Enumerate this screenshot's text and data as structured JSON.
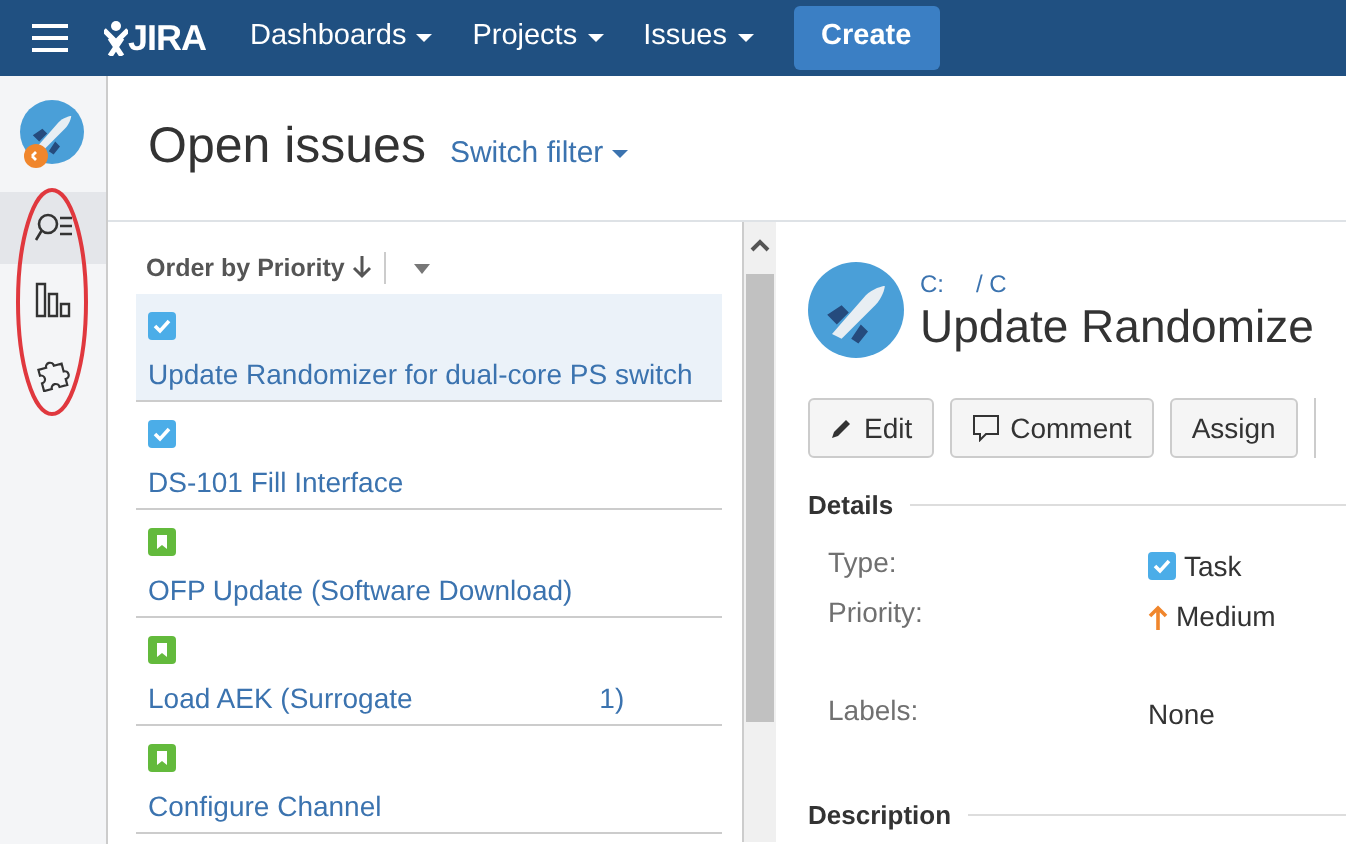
{
  "navbar": {
    "logo": "JIRA",
    "menus": [
      "Dashboards",
      "Projects",
      "Issues"
    ],
    "create": "Create"
  },
  "sidebar": {
    "items": [
      {
        "kind": "project",
        "selected": false
      },
      {
        "kind": "search",
        "selected": true
      },
      {
        "kind": "reports",
        "selected": false
      },
      {
        "kind": "addons",
        "selected": false
      }
    ]
  },
  "page": {
    "title": "Open issues",
    "switch_filter": "Switch filter"
  },
  "order": {
    "label": "Order by Priority"
  },
  "issues": [
    {
      "kind": "task",
      "summary": "Update Randomizer for dual-core PS switch",
      "selected": true
    },
    {
      "kind": "task",
      "summary": "DS-101 Fill Interface",
      "selected": false
    },
    {
      "kind": "story",
      "summary": "OFP Update (Software Download)",
      "selected": false
    },
    {
      "kind": "story",
      "summary": "Load AEK (Surrogate",
      "summary_end": "1)",
      "selected": false
    },
    {
      "kind": "story",
      "summary": "Configure Channel",
      "selected": false
    }
  ],
  "detail": {
    "breadcrumb": [
      "C:",
      "/ C"
    ],
    "title": "Update Randomize",
    "actions": [
      {
        "kind": "edit",
        "label": "Edit"
      },
      {
        "kind": "comment",
        "label": "Comment"
      },
      {
        "kind": "plain",
        "label": "Assign"
      }
    ],
    "details_heading": "Details",
    "fields": [
      {
        "label": "Type:",
        "value": "Task",
        "kind": "task"
      },
      {
        "label": "Priority:",
        "value": "Medium",
        "kind": "priority"
      },
      {
        "label": "Labels:",
        "value": "None",
        "kind": "labels"
      }
    ],
    "description_heading": "Description"
  }
}
